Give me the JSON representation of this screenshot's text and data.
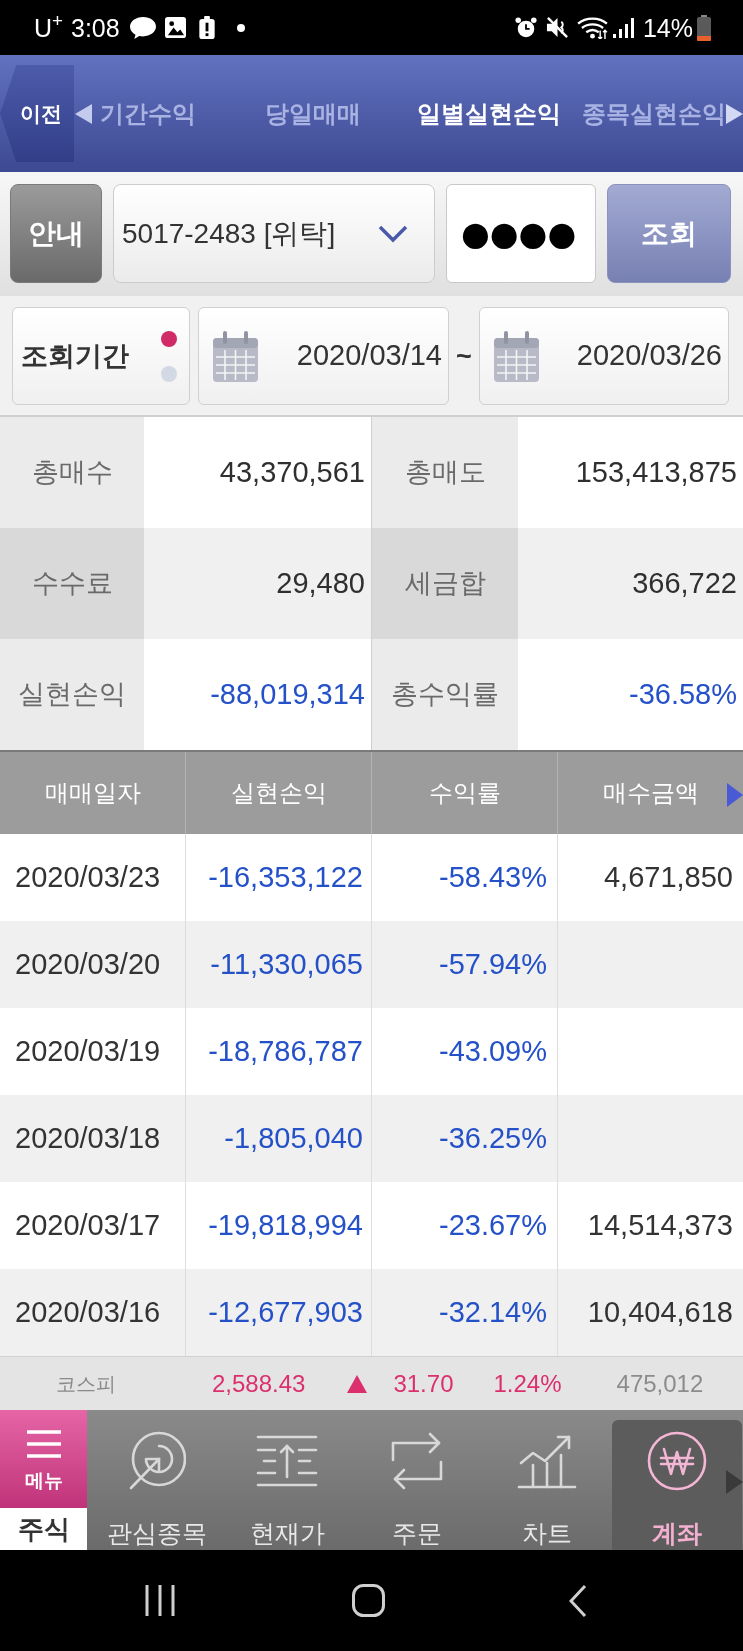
{
  "status_bar": {
    "carrier": "U$^{+}$",
    "time": "3:08",
    "battery": "14%"
  },
  "header": {
    "back_button": "이전",
    "tabs": [
      {
        "label": "기간수익",
        "selected": false
      },
      {
        "label": "당일매매",
        "selected": false
      },
      {
        "label": "일별실현손익",
        "selected": true
      },
      {
        "label": "종목실현손익",
        "selected": false
      }
    ]
  },
  "query": {
    "info_button": "안내",
    "account": "5017-2483 [위탁]",
    "password": "●●●●",
    "search_button": "조회",
    "period_label": "조회기간",
    "period_options": [
      {
        "selected": true
      },
      {
        "selected": false
      }
    ],
    "start_date": "2020/03/14",
    "separator": "~",
    "end_date": "2020/03/26"
  },
  "summary": [
    {
      "label": "총매수",
      "value": "43,370,561",
      "negative": false
    },
    {
      "label": "총매도",
      "value": "153,413,875",
      "negative": false
    },
    {
      "label": "수수료",
      "value": "29,480",
      "negative": false
    },
    {
      "label": "세금합",
      "value": "366,722",
      "negative": false
    },
    {
      "label": "실현손익",
      "value": "-88,019,314",
      "negative": true
    },
    {
      "label": "총수익률",
      "value": "-36.58%",
      "negative": true
    }
  ],
  "table": {
    "columns": [
      "매매일자",
      "실현손익",
      "수익률",
      "매수금액"
    ],
    "rows": [
      {
        "date": "2020/03/23",
        "realized_pnl": "-16,353,122",
        "return_rate": "-58.43%",
        "buy_amount": "4,671,850",
        "negative": true
      },
      {
        "date": "2020/03/20",
        "realized_pnl": "-11,330,065",
        "return_rate": "-57.94%",
        "negative": true
      },
      {
        "date": "2020/03/19",
        "realized_pnl": "-18,786,787",
        "return_rate": "-43.09%",
        "negative": true
      },
      {
        "date": "2020/03/18",
        "realized_pnl": "-1,805,040",
        "return_rate": "-36.25%",
        "negative": true
      },
      {
        "date": "2020/03/17",
        "realized_pnl": "-19,818,994",
        "return_rate": "-23.67%",
        "buy_amount": "14,514,373",
        "negative": true
      },
      {
        "date": "2020/03/16",
        "realized_pnl": "-12,677,903",
        "return_rate": "-32.14%",
        "buy_amount": "10,404,618",
        "negative": true
      }
    ]
  },
  "market_ticker": {
    "name": "코스피",
    "index": "2,588.43",
    "rising": true,
    "change": "31.70",
    "change_rate": "1.24%",
    "volume": "475,012"
  },
  "bottom_nav": {
    "menu_button": "메뉴",
    "section": "주식",
    "items": [
      {
        "label": "관심종목",
        "selected": false
      },
      {
        "label": "현재가",
        "selected": false
      },
      {
        "label": "주문",
        "selected": false
      },
      {
        "label": "차트",
        "selected": false
      },
      {
        "label": "계좌",
        "selected": true
      }
    ]
  }
}
